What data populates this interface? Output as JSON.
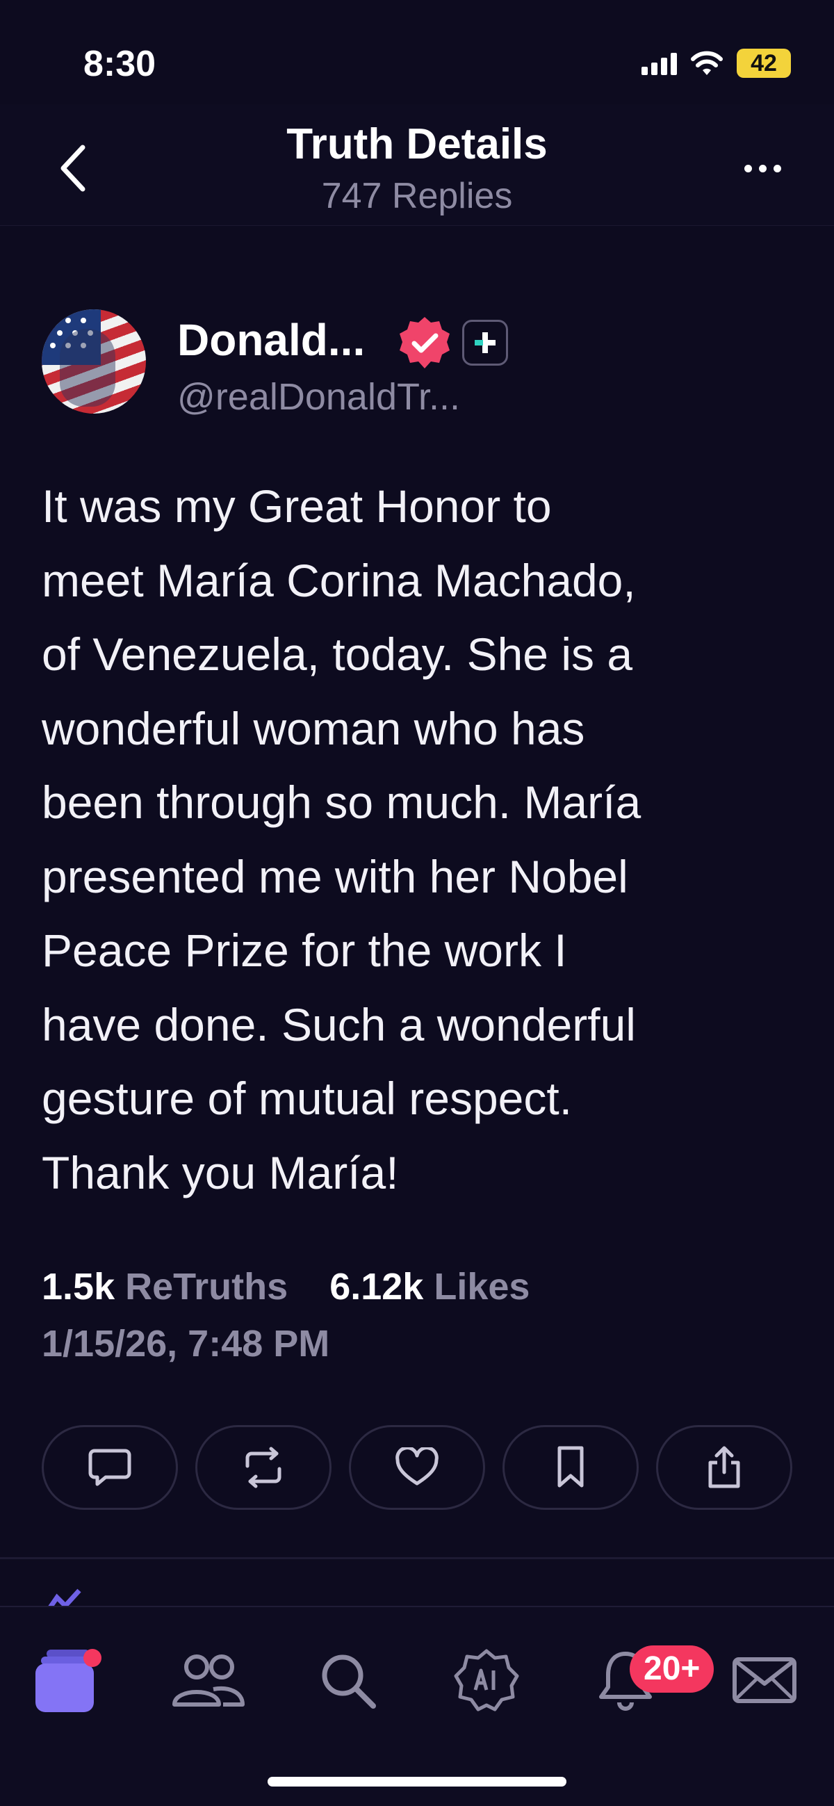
{
  "status_bar": {
    "time": "8:30",
    "battery": "42",
    "icons": [
      "signal-icon",
      "wifi-icon",
      "battery-icon"
    ]
  },
  "header": {
    "title": "Truth Details",
    "subtitle": "747 Replies",
    "icons": [
      "back-icon",
      "more-icon"
    ]
  },
  "author": {
    "name": "Donald...",
    "handle": "@realDonaldTr...",
    "icons": [
      "verified-badge-icon",
      "plus-badge-icon"
    ]
  },
  "post": {
    "lines": [
      "It was my Great Honor to",
      "meet María Corina Machado,",
      "of Venezuela, today. She is a",
      "wonderful woman who has",
      "been through so much. María",
      "presented me with her Nobel",
      "Peace Prize for the work I",
      "have done. Such a wonderful",
      "gesture of mutual respect.",
      "Thank you María!"
    ],
    "retruths_count": "1.5k",
    "retruths_label": "ReTruths",
    "likes_count": "6.12k",
    "likes_label": "Likes",
    "timestamp": "1/15/26, 7:48 PM"
  },
  "actions": [
    "reply-icon",
    "retruth-icon",
    "like-icon",
    "bookmark-icon",
    "share-icon"
  ],
  "tabbar": {
    "items": [
      "home-icon",
      "groups-icon",
      "search-icon",
      "ai-icon",
      "notifications-icon",
      "messages-icon"
    ],
    "notification_badge": "20+"
  },
  "colors": {
    "background": "#0d0b1f",
    "muted": "#8e8ba3",
    "accent": "#7f6ff1",
    "badge": "#f4375f",
    "battery": "#f3d33b"
  }
}
